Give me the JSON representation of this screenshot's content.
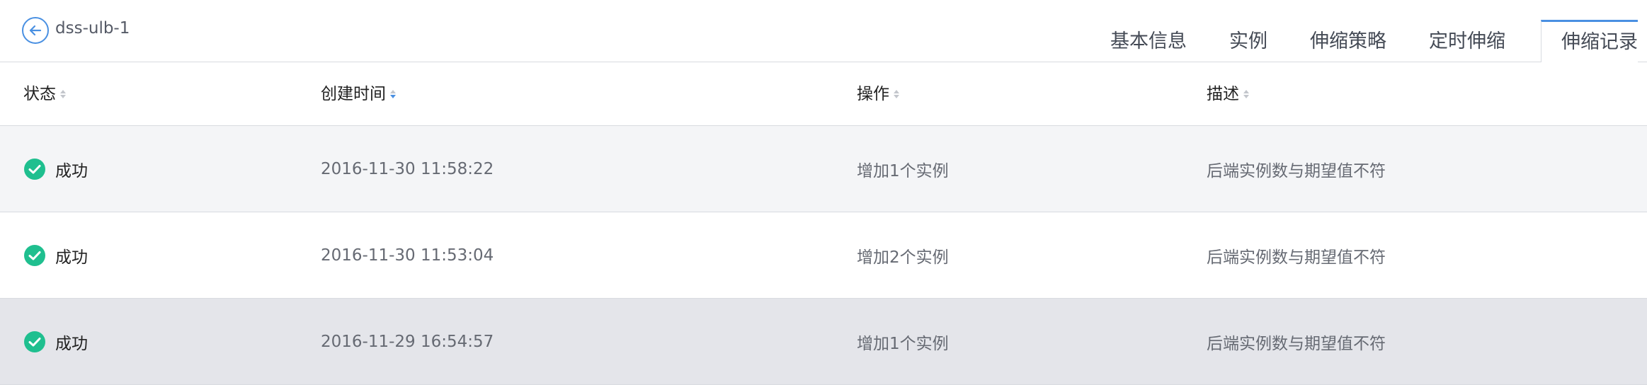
{
  "header": {
    "title": "dss-ulb-1",
    "back_icon": "arrow-left-circle-icon"
  },
  "tabs": [
    {
      "label": "基本信息",
      "active": false
    },
    {
      "label": "实例",
      "active": false
    },
    {
      "label": "伸缩策略",
      "active": false
    },
    {
      "label": "定时伸缩",
      "active": false
    },
    {
      "label": "伸缩记录",
      "active": true
    }
  ],
  "table": {
    "columns": [
      {
        "label": "状态",
        "sort": "none"
      },
      {
        "label": "创建时间",
        "sort": "descending"
      },
      {
        "label": "操作",
        "sort": "none"
      },
      {
        "label": "描述",
        "sort": "none"
      }
    ],
    "rows": [
      {
        "status": "成功",
        "created": "2016-11-30 11:58:22",
        "operation": "增加1个实例",
        "description": "后端实例数与期望值不符"
      },
      {
        "status": "成功",
        "created": "2016-11-30 11:53:04",
        "operation": "增加2个实例",
        "description": "后端实例数与期望值不符"
      },
      {
        "status": "成功",
        "created": "2016-11-29 16:54:57",
        "operation": "增加1个实例",
        "description": "后端实例数与期望值不符"
      }
    ]
  },
  "colors": {
    "accent": "#4a90e2",
    "success": "#1fbf8f",
    "row_alt": "#f4f5f7",
    "row_hover": "#e4e5ea",
    "border": "#d8dbe0"
  }
}
